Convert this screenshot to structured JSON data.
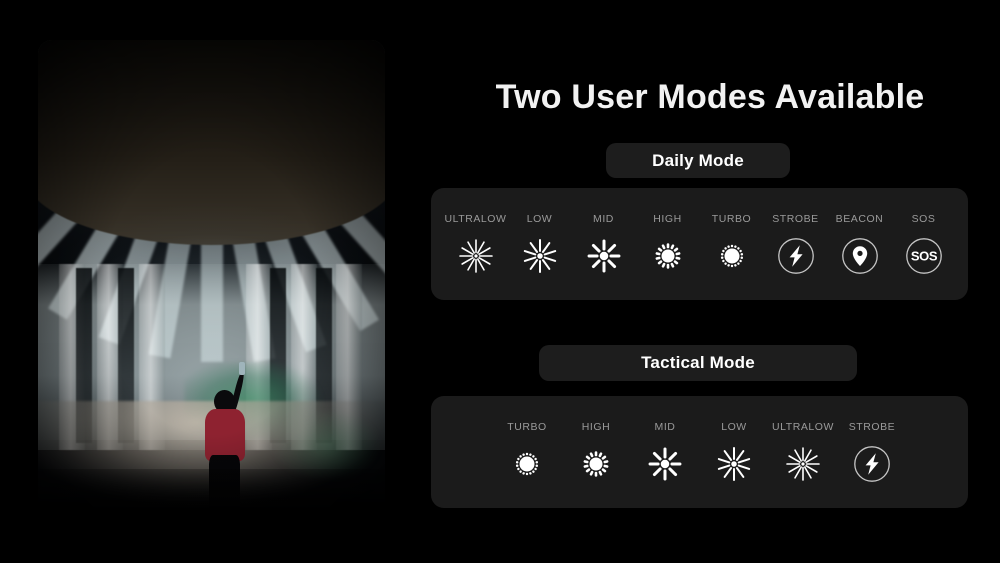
{
  "page": {
    "background_color": "#000000",
    "headline": "Two User Modes Available"
  },
  "photo": {
    "alt_description": "Person in red shirt shining a flashlight up at the concrete underside of a highway overpass at night",
    "accent_shirt_color": "#8e2230",
    "beam_color": "#d6e7ec"
  },
  "daily": {
    "pill_label": "Daily Mode",
    "panel_color": "#1b1b1b",
    "modes": [
      {
        "label": "ULTRALOW",
        "icon": "sunburst-12ray-tiny-core-icon",
        "rays": 12,
        "ray_length": 14,
        "ray_width": 1.6,
        "core": 3.2
      },
      {
        "label": "LOW",
        "icon": "sunburst-10ray-small-core-icon",
        "rays": 10,
        "ray_length": 13,
        "ray_width": 2.0,
        "core": 5.5
      },
      {
        "label": "MID",
        "icon": "sunburst-8ray-medium-core-icon",
        "rays": 8,
        "ray_length": 11,
        "ray_width": 3.0,
        "core": 8.5
      },
      {
        "label": "HIGH",
        "icon": "sun-large-core-short-spikes-icon",
        "rays": 14,
        "ray_length": 5,
        "ray_width": 2.6,
        "core": 13
      },
      {
        "label": "TURBO",
        "icon": "sun-full-disc-icon",
        "rays": 18,
        "ray_length": 2.5,
        "ray_width": 2.4,
        "core": 15
      },
      {
        "label": "STROBE",
        "icon": "lightning-bolt-in-circle-icon"
      },
      {
        "label": "BEACON",
        "icon": "map-pin-in-circle-icon"
      },
      {
        "label": "SOS",
        "icon": "sos-text-in-circle-icon",
        "glyph": "SOS"
      }
    ]
  },
  "tactical": {
    "pill_label": "Tactical Mode",
    "panel_color": "#1b1b1b",
    "modes": [
      {
        "label": "TURBO",
        "icon": "sun-full-disc-icon",
        "rays": 18,
        "ray_length": 2.5,
        "ray_width": 2.4,
        "core": 15
      },
      {
        "label": "HIGH",
        "icon": "sun-large-core-short-spikes-icon",
        "rays": 14,
        "ray_length": 5,
        "ray_width": 2.6,
        "core": 13
      },
      {
        "label": "MID",
        "icon": "sunburst-8ray-medium-core-icon",
        "rays": 8,
        "ray_length": 11,
        "ray_width": 3.0,
        "core": 8.5
      },
      {
        "label": "LOW",
        "icon": "sunburst-10ray-small-core-icon",
        "rays": 10,
        "ray_length": 13,
        "ray_width": 2.0,
        "core": 5.5
      },
      {
        "label": "ULTRALOW",
        "icon": "sunburst-12ray-tiny-core-icon",
        "rays": 12,
        "ray_length": 14,
        "ray_width": 1.6,
        "core": 3.2
      },
      {
        "label": "STROBE",
        "icon": "lightning-bolt-in-circle-icon"
      }
    ]
  },
  "colors": {
    "label_text": "#9a9a9a",
    "icon_white": "#ffffff",
    "pill_background": "#1d1d1d",
    "headline_text": "#f2f2f2"
  }
}
